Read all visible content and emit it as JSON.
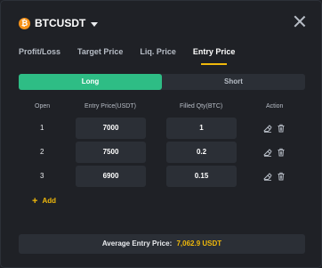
{
  "header": {
    "coin_glyph": "₿",
    "coin_icon": "bitcoin-icon",
    "pair": "BTCUSDT"
  },
  "tabs": [
    {
      "label": "Profit/Loss",
      "active": false
    },
    {
      "label": "Target Price",
      "active": false
    },
    {
      "label": "Liq. Price",
      "active": false
    },
    {
      "label": "Entry Price",
      "active": true
    }
  ],
  "side": {
    "long": "Long",
    "short": "Short",
    "selected": "Long"
  },
  "table": {
    "headers": {
      "open": "Open",
      "price": "Entry Price(USDT)",
      "qty": "Filled Qty(BTC)",
      "action": "Action"
    },
    "rows": [
      {
        "open": "1",
        "price": "7000",
        "qty": "1"
      },
      {
        "open": "2",
        "price": "7500",
        "qty": "0.2"
      },
      {
        "open": "3",
        "price": "6900",
        "qty": "0.15"
      }
    ]
  },
  "add_label": "Add",
  "result": {
    "label": "Average Entry Price:",
    "value": "7,062.9 USDT"
  },
  "colors": {
    "accent": "#f0b90b",
    "long_green": "#2ebd85",
    "bg": "#1f2126",
    "panel": "#2b2f36"
  }
}
